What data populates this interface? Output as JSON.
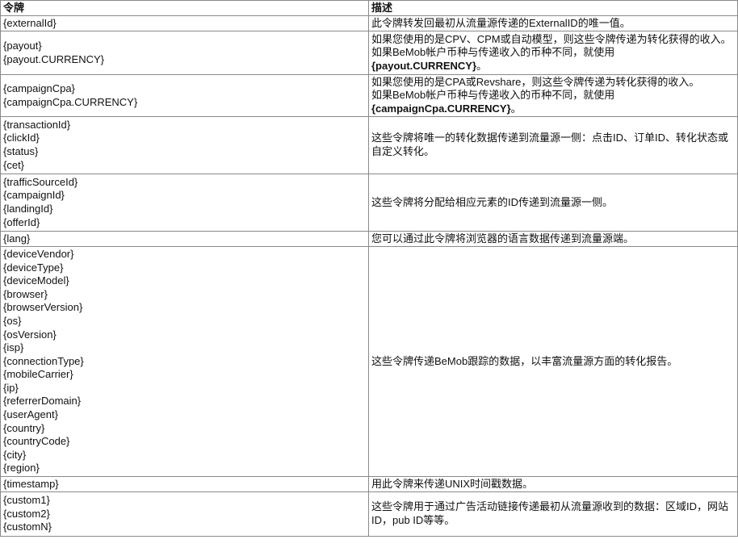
{
  "header": {
    "token": "令牌",
    "description": "描述"
  },
  "rows": [
    {
      "tokens": [
        "{externalId}"
      ],
      "desc": [
        {
          "text": "此令牌转发回最初从流量源传递的ExternalID的唯一值。"
        }
      ]
    },
    {
      "tokens": [
        "{payout}",
        "{payout.CURRENCY}"
      ],
      "desc": [
        {
          "text": "如果您使用的是CPV、CPM或自动模型，则这些令牌传递为转化获得的收入。"
        },
        {
          "text": "如果BeMob帐户币种与传递收入的币种不同，就使用"
        },
        {
          "text": "{payout.CURRENCY}",
          "suffix": "。",
          "bold": true
        }
      ]
    },
    {
      "tokens": [
        "{campaignCpa}",
        "{campaignCpa.CURRENCY}"
      ],
      "desc": [
        {
          "text": "如果您使用的是CPA或Revshare，则这些令牌传递为转化获得的收入。"
        },
        {
          "text": "如果BeMob帐户币种与传递收入的币种不同，就使用"
        },
        {
          "text": "{campaignCpa.CURRENCY}",
          "suffix": "。",
          "bold": true
        }
      ]
    },
    {
      "tokens": [
        "{transactionId}",
        "{clickId}",
        "{status}",
        "{cet}"
      ],
      "desc": [
        {
          "text": "这些令牌将唯一的转化数据传递到流量源一侧：点击ID、订单ID、转化状态或自定义转化。"
        }
      ]
    },
    {
      "tokens": [
        "{trafficSourceId}",
        "{campaignId}",
        "{landingId}",
        "{offerId}"
      ],
      "desc": [
        {
          "text": "这些令牌将分配给相应元素的ID传递到流量源一侧。"
        }
      ]
    },
    {
      "tokens": [
        "{lang}"
      ],
      "desc": [
        {
          "text": "您可以通过此令牌将浏览器的语言数据传递到流量源端。"
        }
      ]
    },
    {
      "tokens": [
        "{deviceVendor}",
        "{deviceType}",
        "{deviceModel}",
        "{browser}",
        "{browserVersion}",
        "{os}",
        "{osVersion}",
        "{isp}",
        "{connectionType}",
        "{mobileCarrier}",
        "{ip}",
        "{referrerDomain}",
        "{userAgent}",
        "{country}",
        "{countryCode}",
        "{city}",
        "{region}"
      ],
      "desc": [
        {
          "text": "这些令牌传递BeMob跟踪的数据，以丰富流量源方面的转化报告。"
        }
      ]
    },
    {
      "tokens": [
        "{timestamp}"
      ],
      "desc": [
        {
          "text": "用此令牌来传递UNIX时间戳数据。"
        }
      ]
    },
    {
      "tokens": [
        "{custom1}",
        "{custom2}",
        "{customN}"
      ],
      "desc": [
        {
          "text": "这些令牌用于通过广告活动链接传递最初从流量源收到的数据：区域ID，网站ID，pub ID等等。"
        }
      ]
    }
  ]
}
